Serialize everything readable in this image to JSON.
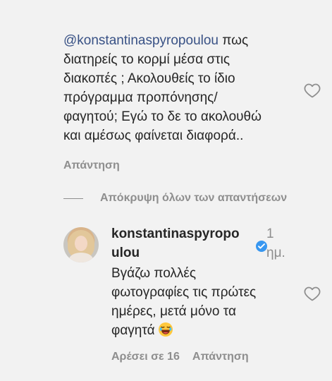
{
  "comment": {
    "mention": "@konstantinaspyropoulou",
    "text_line1_rest": " πως",
    "lines": [
      "διατηρείς το κορμί μέσα στις",
      "διακοπές ; Ακολουθείς το ίδιο",
      "πρόγραμμα προπόνησης/",
      "φαγητού; Εγώ το δε το ακολουθώ",
      "και αμέσως φαίνεται διαφορά.."
    ],
    "reply_label": "Απάντηση",
    "heart_icon": "heart-outline-icon"
  },
  "thread": {
    "hide_replies_label": "Απόκρυψη όλων των απαντήσεων"
  },
  "reply": {
    "username_line1": "konstantinaspyropo",
    "username_line2": "ulou",
    "verified_icon": "verified-badge-icon",
    "time_line1": "1",
    "time_line2": "ημ.",
    "lines": [
      "Βγάζω πολλές",
      "φωτογραφίες τις πρώτες",
      "ημέρες, μετά μόνο τα",
      "φαγητά"
    ],
    "emoji": "😂",
    "likes_label": "Αρέσει σε 16",
    "reply_label": "Απάντηση",
    "heart_icon": "heart-outline-icon",
    "avatar_icon": "avatar"
  },
  "colors": {
    "background": "#f2f2f2",
    "mention": "#385185",
    "secondary_text": "#8e8e8e",
    "verified": "#3897f0"
  }
}
